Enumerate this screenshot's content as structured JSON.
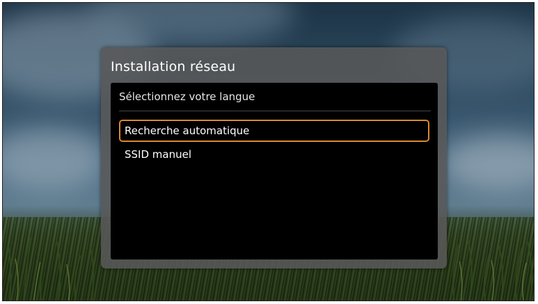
{
  "dialog": {
    "title": "Installation réseau",
    "panel_header": "Sélectionnez votre langue",
    "menu_items": [
      {
        "label": "Recherche automatique",
        "selected": true
      },
      {
        "label": "SSID manuel",
        "selected": false
      }
    ]
  },
  "colors": {
    "selection_border": "#d98a2b",
    "panel_background": "#000000",
    "dialog_background": "#585858"
  }
}
